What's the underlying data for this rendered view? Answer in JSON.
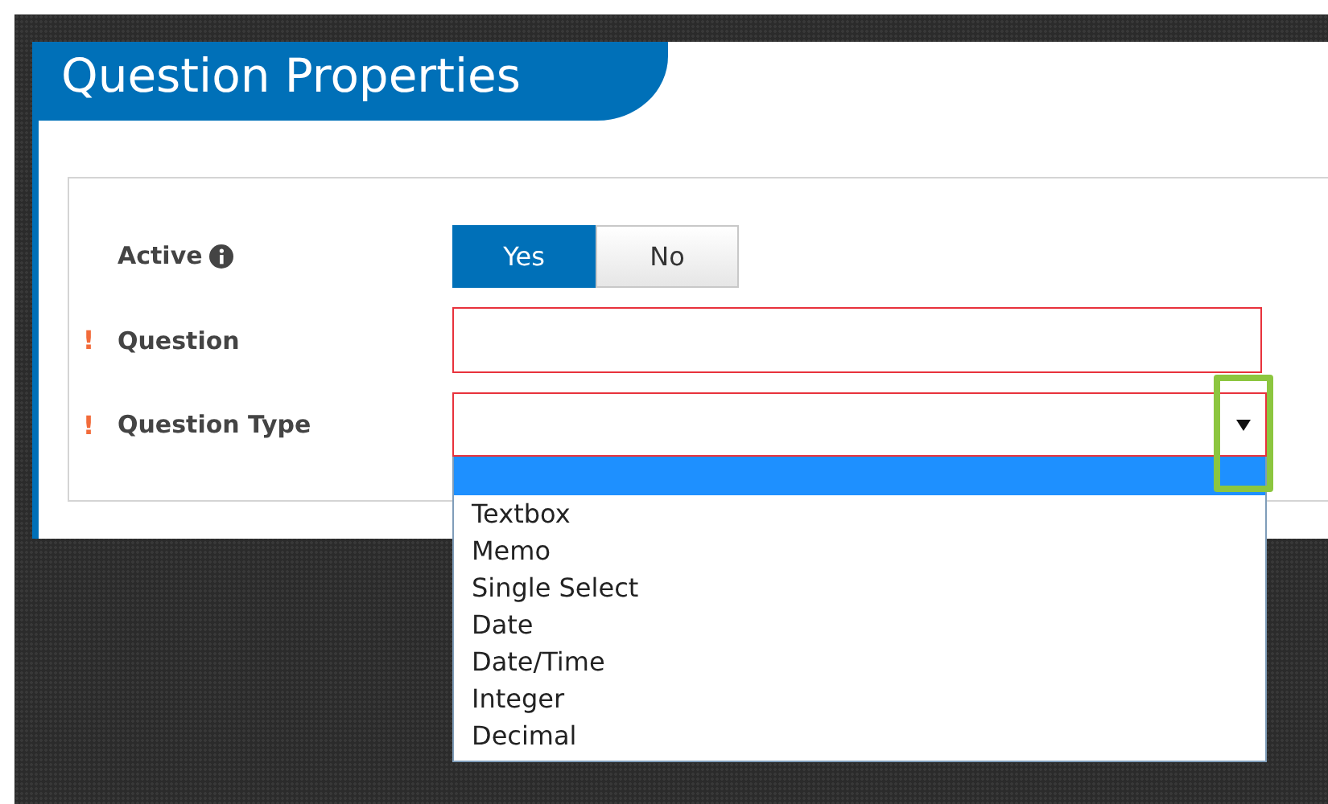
{
  "panel": {
    "title": "Question Properties"
  },
  "fields": [
    {
      "kind": "toggle",
      "label": "Active",
      "info": true,
      "options": [
        {
          "label": "Yes",
          "selected": true
        },
        {
          "label": "No",
          "selected": false
        }
      ]
    },
    {
      "kind": "text",
      "label": "Question",
      "required_mark": "!"
    },
    {
      "kind": "select",
      "label": "Question Type",
      "required_mark": "!",
      "open": true,
      "blank_option": {
        "selected": true
      },
      "options": [
        {
          "label": "Textbox",
          "selected": false
        },
        {
          "label": "Memo",
          "selected": false
        },
        {
          "label": "Single Select",
          "selected": false
        },
        {
          "label": "Date",
          "selected": false
        },
        {
          "label": "Date/Time",
          "selected": false
        },
        {
          "label": "Integer",
          "selected": false
        },
        {
          "label": "Decimal",
          "selected": false
        }
      ]
    }
  ]
}
